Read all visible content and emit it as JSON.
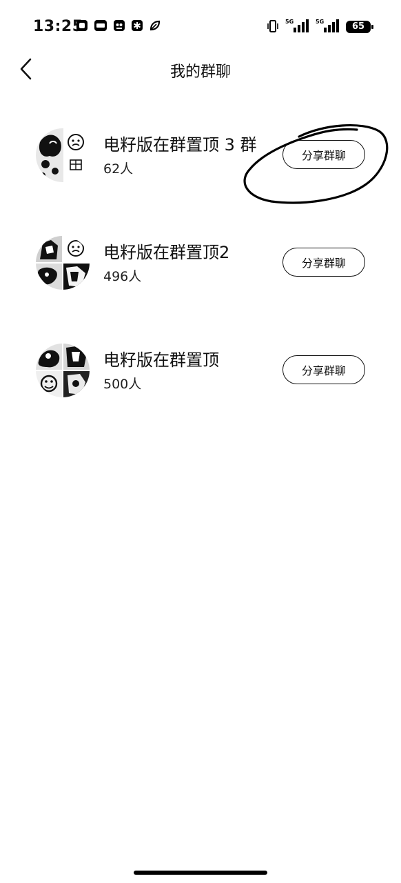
{
  "status_bar": {
    "time": "13:25",
    "notification_icons": [
      "square-app-icon",
      "mail-badge-icon",
      "robot-icon",
      "asterisk-app-icon",
      "leaf-icon"
    ],
    "network_1": "5G",
    "network_2": "5G",
    "battery": "65"
  },
  "header": {
    "title": "我的群聊",
    "back_icon": "chevron-left-icon"
  },
  "groups": [
    {
      "name": "电籽版在群置顶 3 群",
      "members": "62人",
      "share_label": "分享群聊"
    },
    {
      "name": "电籽版在群置顶2",
      "members": "496人",
      "share_label": "分享群聊"
    },
    {
      "name": "电籽版在群置顶",
      "members": "500人",
      "share_label": "分享群聊"
    }
  ]
}
